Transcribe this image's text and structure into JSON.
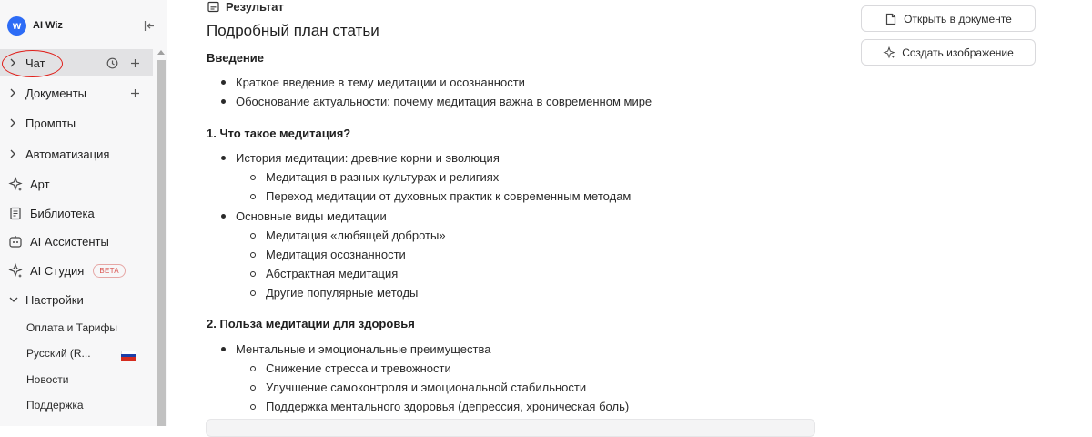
{
  "app": {
    "name": "AI Wiz",
    "logo_letter": "w"
  },
  "sidebar": {
    "items": [
      {
        "label": "Чат"
      },
      {
        "label": "Документы"
      },
      {
        "label": "Промпты"
      },
      {
        "label": "Автоматизация"
      },
      {
        "label": "Арт"
      },
      {
        "label": "Библиотека"
      },
      {
        "label": "AI Ассистенты"
      },
      {
        "label": "AI Студия",
        "badge": "BETA"
      },
      {
        "label": "Настройки"
      }
    ],
    "settings_sub": [
      {
        "label": "Оплата и Тарифы"
      },
      {
        "label": "Русский (R..."
      },
      {
        "label": "Новости"
      },
      {
        "label": "Поддержка"
      }
    ]
  },
  "main": {
    "result_label": "Результат",
    "title": "Подробный план статьи",
    "sections": [
      {
        "title": "Введение",
        "bullets": [
          "Краткое введение в тему медитации и осознанности",
          "Обоснование актуальности: почему медитация важна в современном мире"
        ]
      },
      {
        "title": "1. Что такое медитация?",
        "bullets": [
          "История медитации: древние корни и эволюция",
          "Медитация в разных культурах и религиях",
          "Переход медитации от духовных практик к современным методам",
          "Основные виды медитации",
          "Медитация «любящей доброты»",
          "Медитация осознанности",
          "Абстрактная медитация",
          "Другие популярные методы"
        ]
      },
      {
        "title": "2. Польза медитации для здоровья",
        "bullets": [
          "Ментальные и эмоциональные преимущества",
          "Снижение стресса и тревожности",
          "Улучшение самоконтроля и эмоциональной стабильности",
          "Поддержка ментального здоровья (депрессия, хроническая боль)"
        ]
      }
    ],
    "actions": {
      "open_doc": "Открыть в документе",
      "create_image": "Создать изображение"
    }
  },
  "colors": {
    "accent": "#2d6cf6",
    "highlight_circle": "#e0201b",
    "beta": "#d9534f"
  },
  "icons": [
    "logo-icon",
    "collapse-sidebar-icon",
    "chevron-right-icon",
    "history-icon",
    "plus-icon",
    "sparkle-icon",
    "book-icon",
    "robot-icon",
    "chevron-down-icon",
    "russia-flag-icon",
    "document-icon",
    "result-icon"
  ]
}
